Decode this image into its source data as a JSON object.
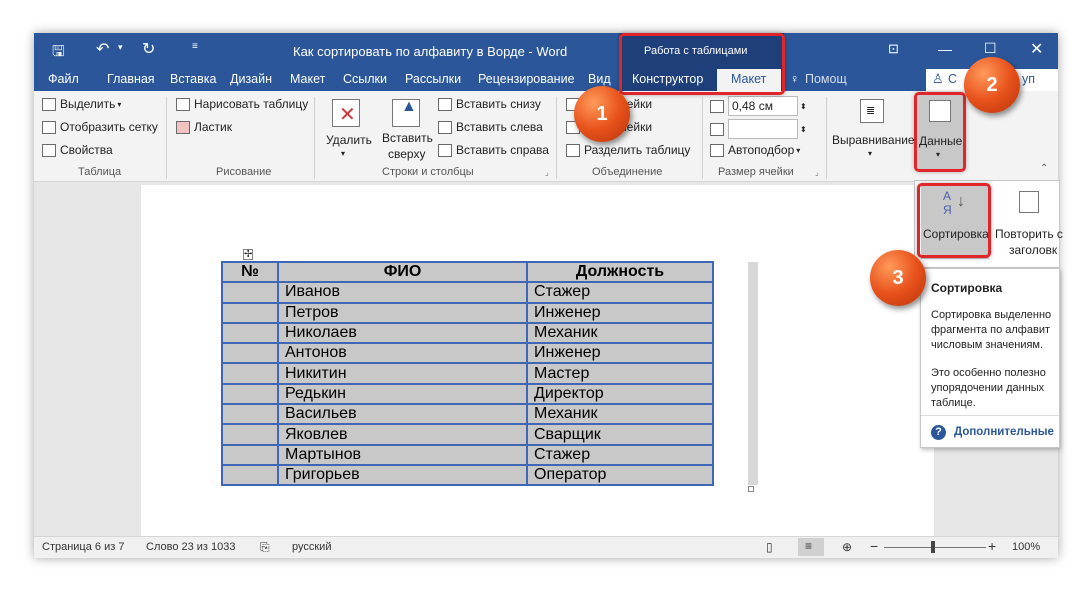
{
  "titlebar": {
    "title": "Как сортировать по алфавиту в Ворде - Word",
    "context_group": "Работа с таблицами"
  },
  "tabs": {
    "file": "Файл",
    "home": "Главная",
    "insert": "Вставка",
    "design": "Дизайн",
    "layout": "Макет",
    "references": "Ссылки",
    "mailings": "Рассылки",
    "review": "Рецензирование",
    "view": "Вид",
    "table_design": "Конструктор",
    "table_layout": "Макет",
    "help": "Помощ",
    "share": "С",
    "share_tail": "уп"
  },
  "ribbon": {
    "select": "Выделить",
    "gridlines": "Отобразить сетку",
    "properties": "Свойства",
    "group_table": "Таблица",
    "draw_table": "Нарисовать таблицу",
    "eraser": "Ластик",
    "group_draw": "Рисование",
    "delete": "Удалить",
    "insert_above_1": "Вставить",
    "insert_above_2": "сверху",
    "insert_below": "Вставить снизу",
    "insert_left": "Вставить слева",
    "insert_right": "Вставить справа",
    "group_rows": "Строки и столбцы",
    "merge_cells": "ячейки",
    "split_cells": "ячейки",
    "split_table": "Разделить таблицу",
    "group_merge": "Объединение",
    "height_value": "0,48 см",
    "width_value": "",
    "autofit": "Автоподбор",
    "group_cellsize": "Размер ячейки",
    "alignment": "Выравнивание",
    "data": "Данные"
  },
  "dropdown": {
    "sort": "Сортировка",
    "repeat_header_1": "Повторить с",
    "repeat_header_2": "заголовк"
  },
  "tooltip": {
    "title": "Сортировка",
    "desc1": "Сортировка выделенно",
    "desc2": "фрагмента по алфавит",
    "desc3": "числовым значениям.",
    "desc4": "Это особенно полезно",
    "desc5": "упорядочении данных",
    "desc6": "таблице.",
    "more": "Дополнительные"
  },
  "badges": {
    "one": "1",
    "two": "2",
    "three": "3"
  },
  "table": {
    "headers": [
      "№",
      "ФИО",
      "Должность"
    ],
    "rows": [
      [
        "",
        "Иванов",
        "Стажер"
      ],
      [
        "",
        "Петров",
        "Инженер"
      ],
      [
        "",
        "Николаев",
        "Механик"
      ],
      [
        "",
        "Антонов",
        "Инженер"
      ],
      [
        "",
        "Никитин",
        "Мастер"
      ],
      [
        "",
        "Редькин",
        "Директор"
      ],
      [
        "",
        "Васильев",
        "Механик"
      ],
      [
        "",
        "Яковлев",
        "Сварщик"
      ],
      [
        "",
        "Мартынов",
        "Стажер"
      ],
      [
        "",
        "Григорьев",
        "Оператор"
      ]
    ]
  },
  "status": {
    "page": "Страница 6 из 7",
    "words": "Слово 23 из 1033",
    "language": "русский",
    "zoom": "100%"
  },
  "colors": {
    "accent": "#2b579a",
    "highlight": "#e0262a",
    "badge": "#e8521c"
  }
}
